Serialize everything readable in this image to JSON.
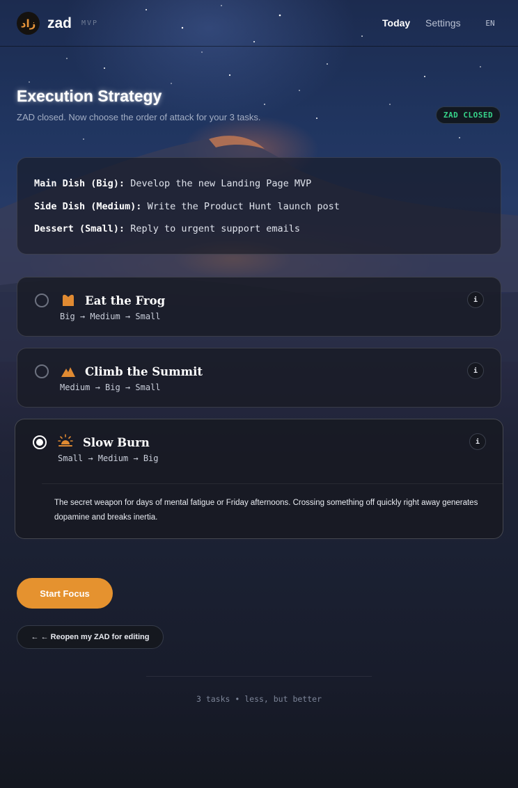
{
  "header": {
    "logo_text": "ﺯﺍﺩ",
    "brand": "zad",
    "tag": "MVP",
    "nav": {
      "today": "Today",
      "settings": "Settings",
      "lang": "EN"
    }
  },
  "page": {
    "title": "Execution Strategy",
    "subtitle": "ZAD closed. Now choose the order of attack for your 3 tasks.",
    "status_badge": "ZAD CLOSED",
    "status_color": "#36d48a"
  },
  "summary": {
    "main_label": "Main Dish (Big):",
    "main_value": "Develop the new Landing Page MVP",
    "side_label": "Side Dish (Medium):",
    "side_value": "Write the Product Hunt launch post",
    "dessert_label": "Dessert (Small):",
    "dessert_value": "Reply to urgent support emails"
  },
  "strategies": [
    {
      "title": "Eat the Frog",
      "order": "Big → Medium → Small",
      "icon": "frog-icon",
      "selected": false,
      "info": "i"
    },
    {
      "title": "Climb the Summit",
      "order": "Medium → Big → Small",
      "icon": "mountain-icon",
      "selected": false,
      "info": "i"
    },
    {
      "title": "Slow Burn",
      "order": "Small → Medium → Big",
      "icon": "sunrise-icon",
      "selected": true,
      "info": "i",
      "description": "The secret weapon for days of mental fatigue or Friday afternoons. Crossing something off quickly right away generates dopamine and breaks inertia."
    }
  ],
  "actions": {
    "start": "Start Focus",
    "reopen": "← ← Reopen my ZAD for editing"
  },
  "footer": "3 tasks • less, but better",
  "colors": {
    "accent": "#e5922f",
    "icon": "#e08a32"
  }
}
